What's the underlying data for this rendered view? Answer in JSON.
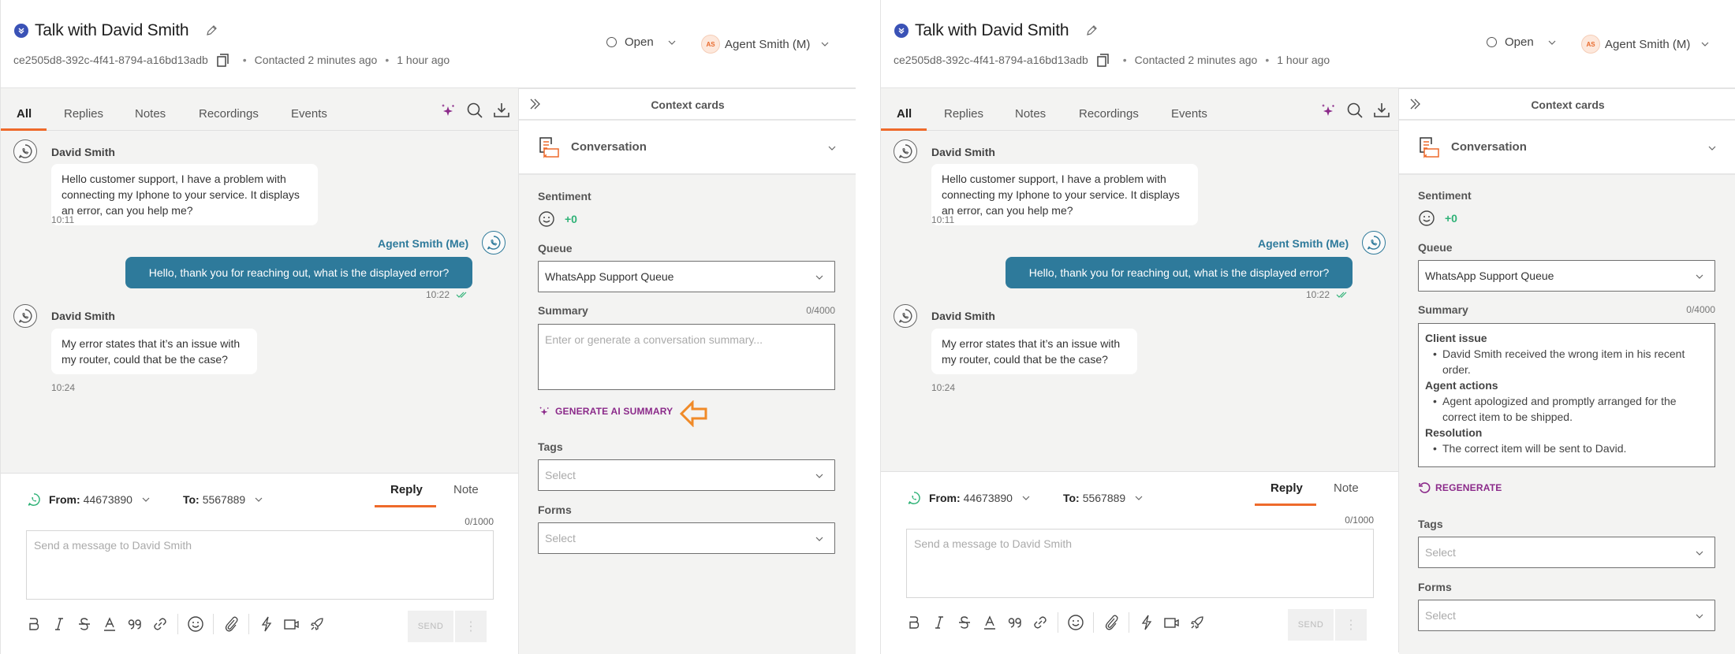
{
  "panels": [
    {
      "header": {
        "title": "Talk with David Smith",
        "conversation_id": "ce2505d8-392c-4f41-8794-a16bd13adb",
        "contacted": "Contacted 2 minutes ago",
        "created": "1 hour ago",
        "status": "Open",
        "agent_initials": "AS",
        "agent_name": "Agent Smith (M)"
      },
      "tabs": [
        {
          "label": "All",
          "active": true
        },
        {
          "label": "Replies",
          "active": false
        },
        {
          "label": "Notes",
          "active": false
        },
        {
          "label": "Recordings",
          "active": false
        },
        {
          "label": "Events",
          "active": false
        }
      ],
      "messages": [
        {
          "sender": "David Smith",
          "direction": "in",
          "text": "Hello customer support, I have a problem with connecting my Iphone to your service. It displays an error, can you help me?",
          "time": "10:11"
        },
        {
          "sender": "Agent Smith (Me)",
          "direction": "out",
          "text": "Hello, thank you for reaching out, what is the displayed error?",
          "time": "10:22"
        },
        {
          "sender": "David Smith",
          "direction": "in",
          "text": "My error states that it’s an issue with my router, could that be the case?",
          "time": "10:24"
        }
      ],
      "compose": {
        "from_label": "From:",
        "from_value": "44673890",
        "to_label": "To:",
        "to_value": "5567889",
        "reply_tab": "Reply",
        "note_tab": "Note",
        "counter": "0/1000",
        "placeholder": "Send a message to David Smith",
        "send_label": "SEND"
      },
      "context": {
        "title": "Context cards",
        "card_title": "Conversation",
        "sentiment_label": "Sentiment",
        "sentiment_value": "+0",
        "queue_label": "Queue",
        "queue_value": "WhatsApp Support Queue",
        "summary_label": "Summary",
        "summary_counter": "0/4000",
        "summary_placeholder": "Enter or generate a conversation summary...",
        "ai_button": "GENERATE AI SUMMARY",
        "tags_label": "Tags",
        "tags_placeholder": "Select",
        "forms_label": "Forms",
        "forms_placeholder": "Select"
      }
    },
    {
      "header": {
        "title": "Talk with David Smith",
        "conversation_id": "ce2505d8-392c-4f41-8794-a16bd13adb",
        "contacted": "Contacted 2 minutes ago",
        "created": "1 hour ago",
        "status": "Open",
        "agent_initials": "AS",
        "agent_name": "Agent Smith (M)"
      },
      "tabs": [
        {
          "label": "All",
          "active": true
        },
        {
          "label": "Replies",
          "active": false
        },
        {
          "label": "Notes",
          "active": false
        },
        {
          "label": "Recordings",
          "active": false
        },
        {
          "label": "Events",
          "active": false
        }
      ],
      "messages": [
        {
          "sender": "David Smith",
          "direction": "in",
          "text": "Hello customer support, I have a problem with connecting my Iphone to your service. It displays an error, can you help me?",
          "time": "10:11"
        },
        {
          "sender": "Agent Smith (Me)",
          "direction": "out",
          "text": "Hello, thank you for reaching out, what is the displayed error?",
          "time": "10:22"
        },
        {
          "sender": "David Smith",
          "direction": "in",
          "text": "My error states that it’s an issue with my router, could that be the case?",
          "time": "10:24"
        }
      ],
      "compose": {
        "from_label": "From:",
        "from_value": "44673890",
        "to_label": "To:",
        "to_value": "5567889",
        "reply_tab": "Reply",
        "note_tab": "Note",
        "counter": "0/1000",
        "placeholder": "Send a message to David Smith",
        "send_label": "SEND"
      },
      "context": {
        "title": "Context cards",
        "card_title": "Conversation",
        "sentiment_label": "Sentiment",
        "sentiment_value": "+0",
        "queue_label": "Queue",
        "queue_value": "WhatsApp Support Queue",
        "summary_label": "Summary",
        "summary_counter": "0/4000",
        "summary_sections": [
          {
            "heading": "Client issue",
            "items": [
              "David Smith received the wrong item in his recent order."
            ]
          },
          {
            "heading": "Agent actions",
            "items": [
              "Agent apologized and promptly arranged for the correct item to be shipped."
            ]
          },
          {
            "heading": "Resolution",
            "items": [
              "The correct item will be sent to David."
            ]
          }
        ],
        "ai_button": "REGENERATE",
        "tags_label": "Tags",
        "tags_placeholder": "Select",
        "forms_label": "Forms",
        "forms_placeholder": "Select"
      }
    }
  ],
  "colors": {
    "accent_orange": "#ee6a2b",
    "agent_bubble": "#2e7a9b",
    "ai_purple": "#8b2a8a",
    "sentiment_green": "#2fb277",
    "priority_blue": "#3a52b6"
  }
}
